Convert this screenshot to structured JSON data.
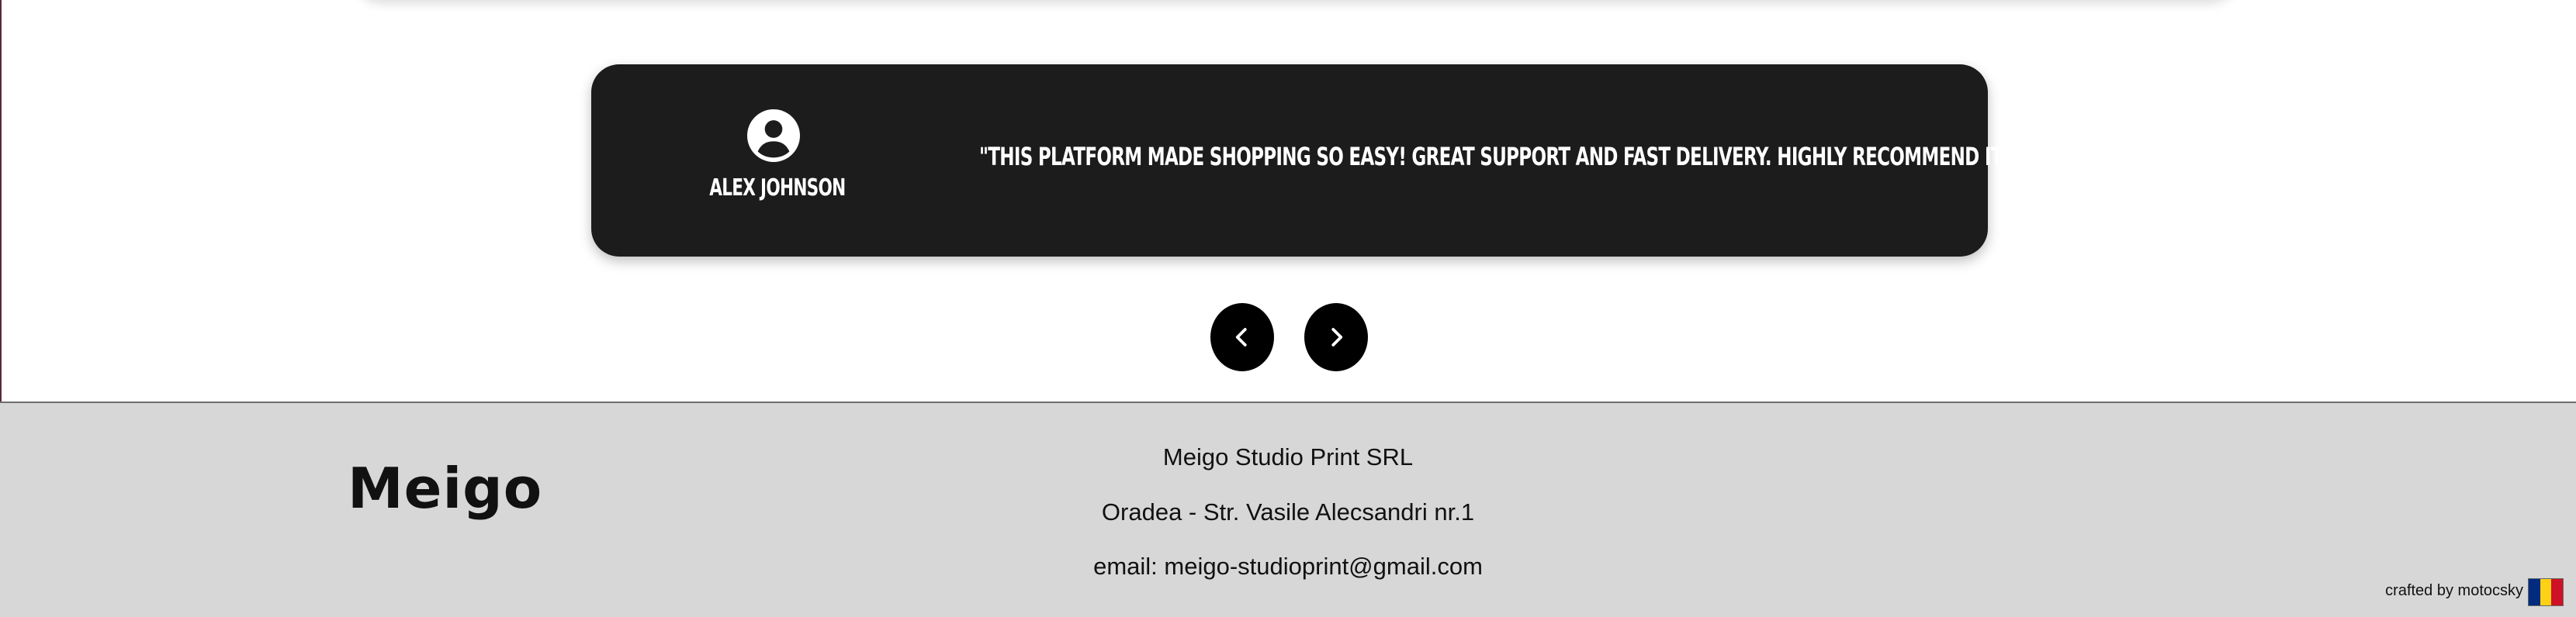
{
  "testimonial": {
    "author_name": "ALEX JOHNSON",
    "quote": "\"THIS PLATFORM MADE SHOPPING SO EASY! GREAT SUPPORT AND FAST DELIVERY. HIGHLY RECOMMEND IT!\"",
    "avatar_icon": "user-circle-icon"
  },
  "navigation": {
    "prev_icon": "chevron-left-icon",
    "next_icon": "chevron-right-icon"
  },
  "footer": {
    "logo": "Meigo",
    "company": "Meigo Studio Print SRL",
    "address": "Oradea - Str. Vasile Alecsandri nr.1",
    "email": "email: meigo-studioprint@gmail.com",
    "credit": "crafted by motocsky",
    "flag_colors": [
      "#002B7F",
      "#FCD116",
      "#CE1126"
    ]
  },
  "colors": {
    "card_bg": "#1c1c1c",
    "footer_bg": "#d7d7d7",
    "button_bg": "#000000"
  }
}
